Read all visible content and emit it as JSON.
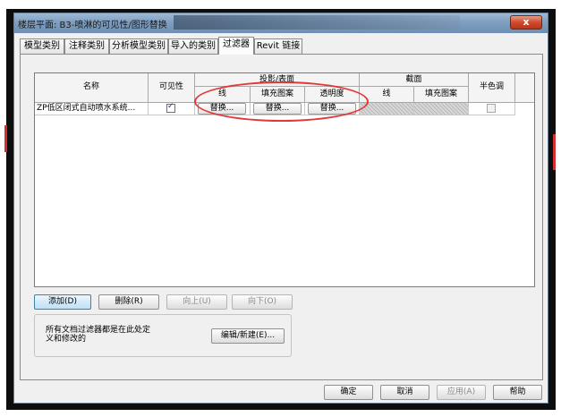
{
  "window": {
    "title": "楼层平面: B3-喷淋的可见性/图形替换",
    "close_glyph": "x"
  },
  "tabs": [
    {
      "label": "模型类别"
    },
    {
      "label": "注释类别"
    },
    {
      "label": "分析模型类别"
    },
    {
      "label": "导入的类别"
    },
    {
      "label": "过滤器"
    },
    {
      "label": "Revit 链接"
    }
  ],
  "active_tab": "过滤器",
  "table": {
    "headers": {
      "name": "名称",
      "visibility": "可见性",
      "projection_group": "投影/表面",
      "projection_line": "线",
      "projection_pattern": "填充图案",
      "projection_transparency": "透明度",
      "cut_group": "截面",
      "cut_line": "线",
      "cut_pattern": "填充图案",
      "halftone": "半色调"
    },
    "rows": [
      {
        "name": "ZP低区闭式自动喷水系统...",
        "visible": true,
        "projection_line": "替换...",
        "projection_pattern": "替换...",
        "projection_transparency": "替换...",
        "halftone": false
      }
    ]
  },
  "buttons": {
    "add": "添加(D)",
    "delete": "删除(R)",
    "move_up": "向上(U)",
    "move_down": "向下(O)",
    "edit_new": "编辑/新建(E)...",
    "ok": "确定",
    "cancel": "取消",
    "apply": "应用(A)",
    "help": "帮助"
  },
  "info": {
    "text": "所有文档过滤器都是在此处定义和修改的"
  },
  "colors": {
    "highlight": "#e0393a",
    "titlebar": "#7f9ec0",
    "close": "#cf4a2c"
  }
}
